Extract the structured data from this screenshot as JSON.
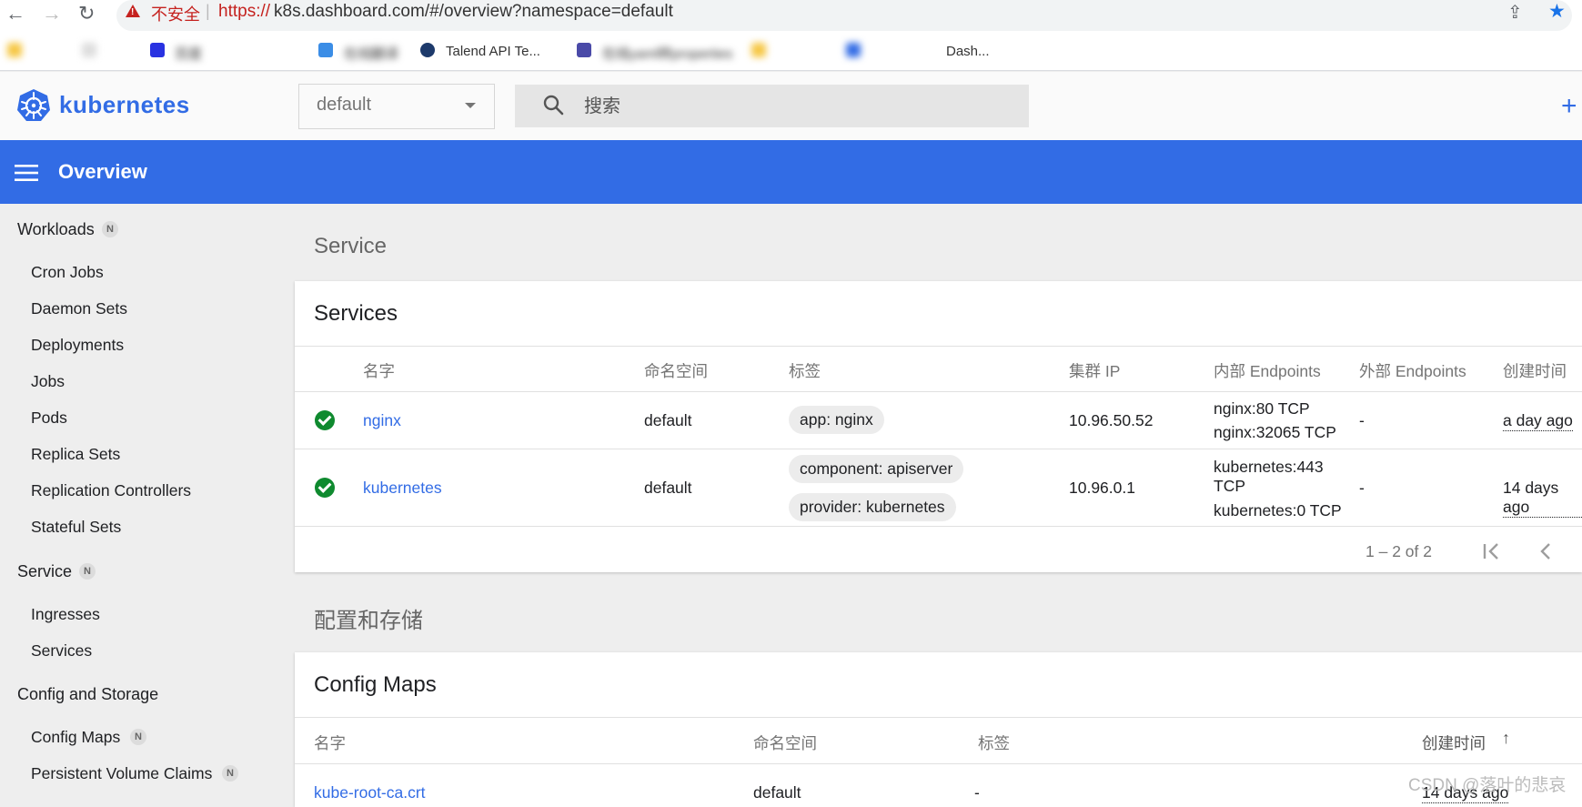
{
  "browser": {
    "back": "←",
    "forward": "→",
    "reload": "↻",
    "insecure_label": "不安全",
    "url_scheme": "https://",
    "url_rest": "k8s.dashboard.com/#/overview?namespace=default",
    "bookmarks": [
      "百度",
      "在线翻译",
      "Talend API Te...",
      "在线yaml转properties",
      "Dash..."
    ]
  },
  "header": {
    "logo_text": "kubernetes",
    "namespace": "default",
    "search_placeholder": "搜索",
    "create_icon": "+"
  },
  "toolbar": {
    "title": "Overview"
  },
  "sidebar": {
    "workloads": {
      "label": "Workloads",
      "badge": "N",
      "items": [
        "Cron Jobs",
        "Daemon Sets",
        "Deployments",
        "Jobs",
        "Pods",
        "Replica Sets",
        "Replication Controllers",
        "Stateful Sets"
      ]
    },
    "service": {
      "label": "Service",
      "badge": "N",
      "items": [
        "Ingresses",
        "Services"
      ]
    },
    "config": {
      "label": "Config and Storage",
      "items": [
        {
          "label": "Config Maps",
          "badge": "N"
        },
        {
          "label": "Persistent Volume Claims",
          "badge": "N"
        }
      ]
    }
  },
  "service_section": {
    "title": "Service",
    "card_title": "Services",
    "columns": [
      "名字",
      "命名空间",
      "标签",
      "集群 IP",
      "内部 Endpoints",
      "外部 Endpoints",
      "创建时间"
    ],
    "rows": [
      {
        "name": "nginx",
        "namespace": "default",
        "labels": [
          "app: nginx"
        ],
        "cluster_ip": "10.96.50.52",
        "internal": [
          "nginx:80 TCP",
          "nginx:32065 TCP"
        ],
        "external": "-",
        "created": "a day ago"
      },
      {
        "name": "kubernetes",
        "namespace": "default",
        "labels": [
          "component: apiserver",
          "provider: kubernetes"
        ],
        "cluster_ip": "10.96.0.1",
        "internal": [
          "kubernetes:443",
          "TCP",
          "kubernetes:0 TCP"
        ],
        "external": "-",
        "created": "14 days ago"
      }
    ],
    "pagination": "1 – 2 of 2"
  },
  "config_section": {
    "title": "配置和存储",
    "card_title": "Config Maps",
    "columns": [
      "名字",
      "命名空间",
      "标签",
      "创建时间"
    ],
    "sort_icon": "↑",
    "rows": [
      {
        "name": "kube-root-ca.crt",
        "namespace": "default",
        "labels": "-",
        "created": "14 days ago"
      }
    ]
  },
  "watermark": "CSDN @落叶的悲哀"
}
